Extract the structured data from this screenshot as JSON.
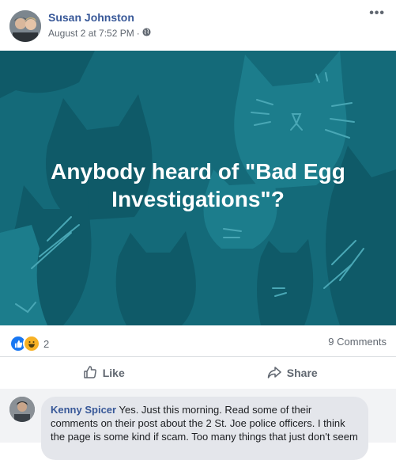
{
  "post": {
    "author": "Susan Johnston",
    "timestamp": "August 2 at 7:52 PM",
    "separator": "·",
    "more_label": "•••",
    "headline_line1": "Anybody heard of \"Bad Egg",
    "headline_line2": "Investigations\"?",
    "banner_color": "#146a79"
  },
  "stats": {
    "reaction_count": "2",
    "comments_label": "9 Comments",
    "reaction_icons": [
      "like-icon",
      "haha-icon"
    ]
  },
  "actions": {
    "like_label": "Like",
    "share_label": "Share"
  },
  "comment": {
    "author": "Kenny Spicer",
    "text": "Yes. Just this morning. Read some of their comments on their post about the 2 St. Joe police officers. I think the page is some kind if scam. Too many things that just don't seem"
  },
  "colors": {
    "link": "#385898",
    "like_blue": "#1877f2",
    "haha_yellow": "#f7b125"
  }
}
